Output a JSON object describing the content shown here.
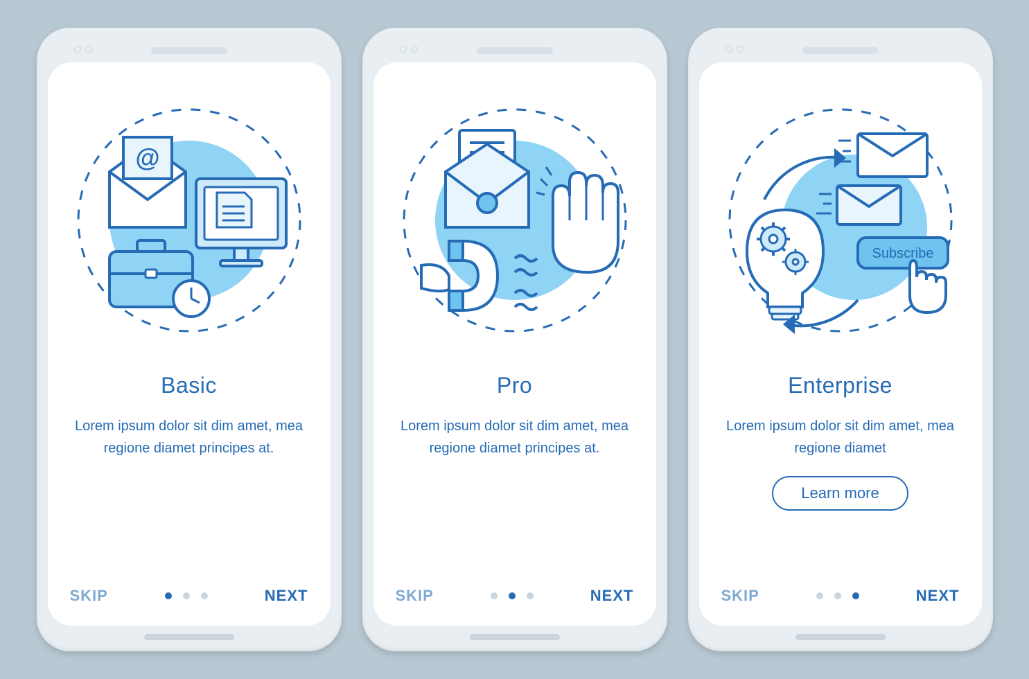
{
  "colors": {
    "primary": "#256bb5",
    "accent": "#6ec4ef",
    "accent_light": "#a7ddfa",
    "muted": "#c9d4db"
  },
  "screens": [
    {
      "icon": "email-briefcase-computer-illustration",
      "title": "Basic",
      "description": "Lorem ipsum dolor sit dim amet, mea regione diamet principes at.",
      "skip_label": "SKIP",
      "next_label": "NEXT",
      "active_dot": 0,
      "has_learn_more": false
    },
    {
      "icon": "letter-magnet-hand-illustration",
      "title": "Pro",
      "description": "Lorem ipsum dolor sit dim amet, mea regione diamet principes at.",
      "skip_label": "SKIP",
      "next_label": "NEXT",
      "active_dot": 1,
      "has_learn_more": false
    },
    {
      "icon": "lightbulb-subscribe-envelope-illustration",
      "title": "Enterprise",
      "description": "Lorem ipsum dolor sit dim amet, mea regione diamet",
      "skip_label": "SKIP",
      "next_label": "NEXT",
      "active_dot": 2,
      "has_learn_more": true,
      "learn_more_label": "Learn more",
      "subscribe_label": "Subscribe"
    }
  ],
  "total_dots": 3
}
